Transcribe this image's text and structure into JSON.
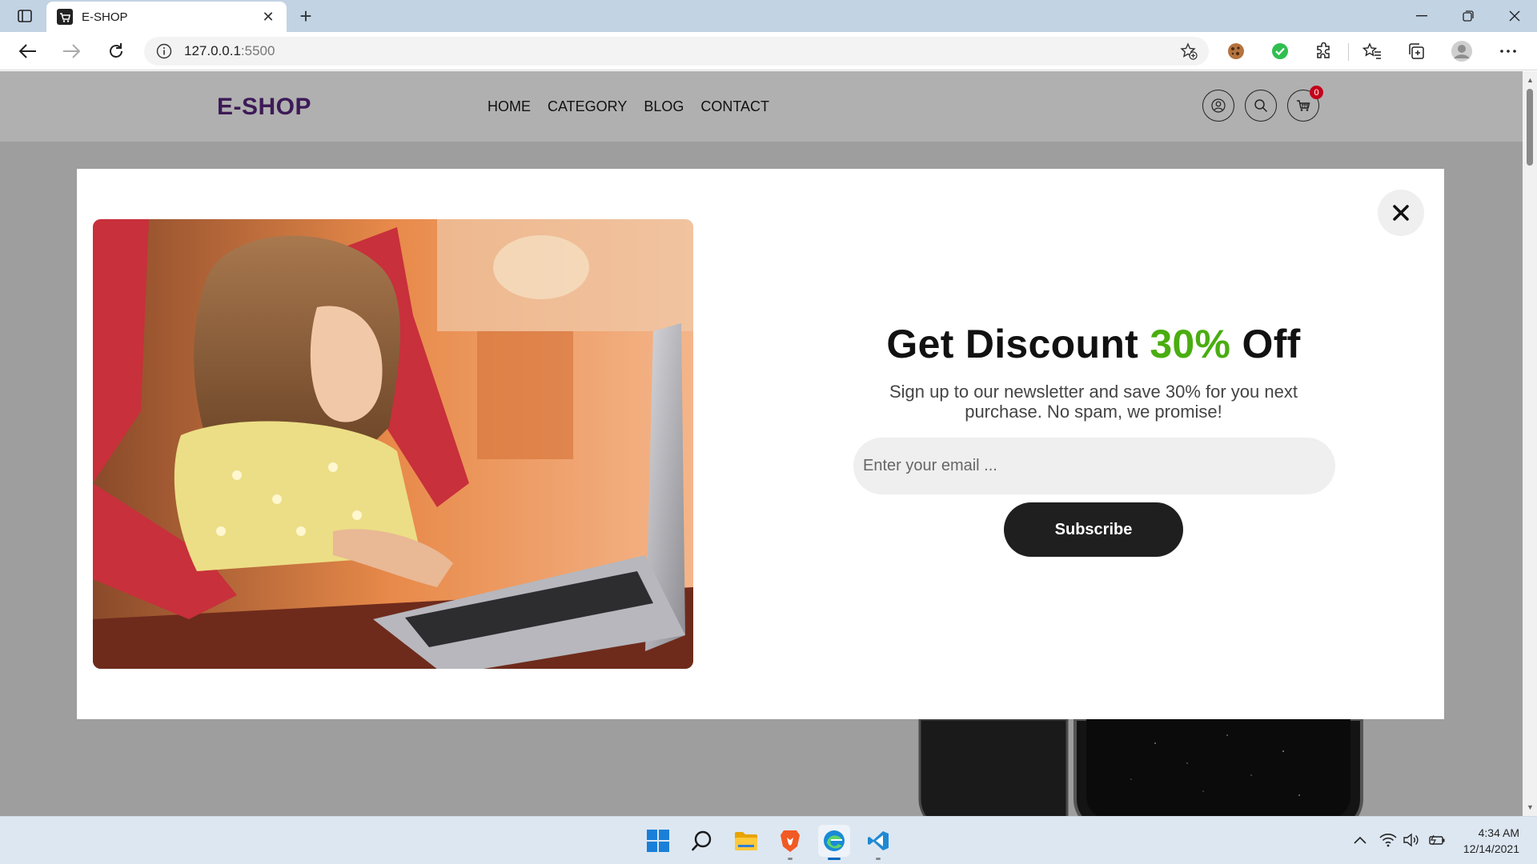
{
  "browser": {
    "tab_title": "E-SHOP",
    "address": "127.0.0.1",
    "address_port": ":5500",
    "colors": {
      "tabbar": "#c2d3e3"
    }
  },
  "site": {
    "logo": "E-SHOP",
    "logo_color": "#3d1a57",
    "nav": [
      "HOME",
      "CATEGORY",
      "BLOG",
      "CONTACT"
    ],
    "cart_count": "0"
  },
  "modal": {
    "title_prefix": "Get Discount ",
    "title_accent": "30%",
    "title_suffix": " Off",
    "accent_color": "#4aad10",
    "subtitle": "Sign up to our newsletter and save 30% for you next purchase. No spam, we promise!",
    "email_placeholder": "Enter your email ...",
    "subscribe_label": "Subscribe"
  },
  "taskbar": {
    "time": "4:34 AM",
    "date": "12/14/2021",
    "apps": [
      "start-icon",
      "search-icon",
      "file-explorer-icon",
      "brave-icon",
      "edge-icon",
      "vscode-icon"
    ]
  }
}
